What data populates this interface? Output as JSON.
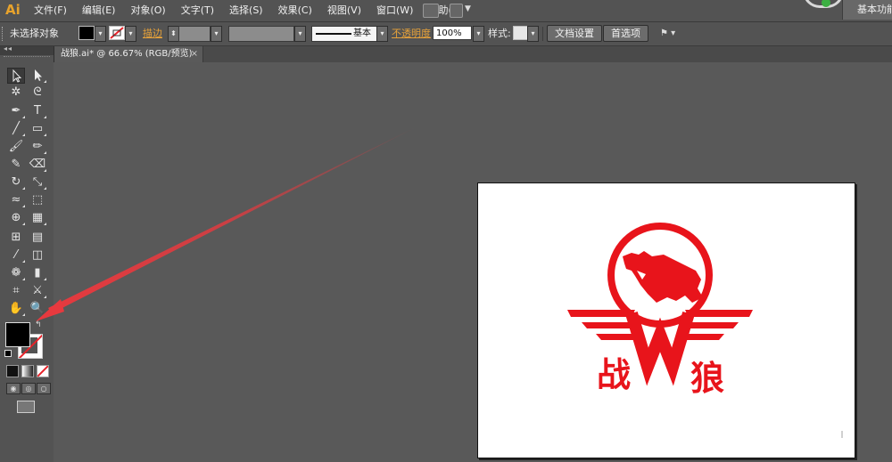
{
  "app": {
    "logo": "Ai"
  },
  "menu": [
    "文件(F)",
    "编辑(E)",
    "对象(O)",
    "文字(T)",
    "选择(S)",
    "效果(C)",
    "视图(V)",
    "窗口(W)",
    "帮助(H)"
  ],
  "workspace": {
    "label": "基本功能"
  },
  "control_bar": {
    "selection_label": "未选择对象",
    "stroke_label": "描边",
    "stroke_profile": "基本",
    "opacity_label": "不透明度",
    "opacity_value": "100%",
    "style_label": "样式",
    "document_setup_label": "文档设置",
    "preferences_label": "首选项"
  },
  "document_tab": {
    "title": "战狼.ai* @ 66.67% (RGB/预览)",
    "close": "×"
  },
  "artboard": {
    "logo_text": [
      "战",
      "狼"
    ],
    "logo_color": "#e8141b"
  },
  "annotation": {
    "arrow_color": "#e8393e"
  },
  "toolbox": {
    "tools": [
      "selection-tool",
      "direct-selection-tool",
      "magic-wand-tool",
      "lasso-tool",
      "pen-tool",
      "type-tool",
      "line-segment-tool",
      "rectangle-tool",
      "paintbrush-tool",
      "pencil-tool",
      "blob-brush-tool",
      "eraser-tool",
      "rotate-tool",
      "scale-tool",
      "width-tool",
      "free-transform-tool",
      "shape-builder-tool",
      "perspective-grid-tool",
      "mesh-tool",
      "gradient-tool",
      "eyedropper-tool",
      "blend-tool",
      "symbol-sprayer-tool",
      "column-graph-tool",
      "artboard-tool",
      "slice-tool",
      "hand-tool",
      "zoom-tool"
    ],
    "fill_color": "#000000",
    "stroke": "none"
  }
}
